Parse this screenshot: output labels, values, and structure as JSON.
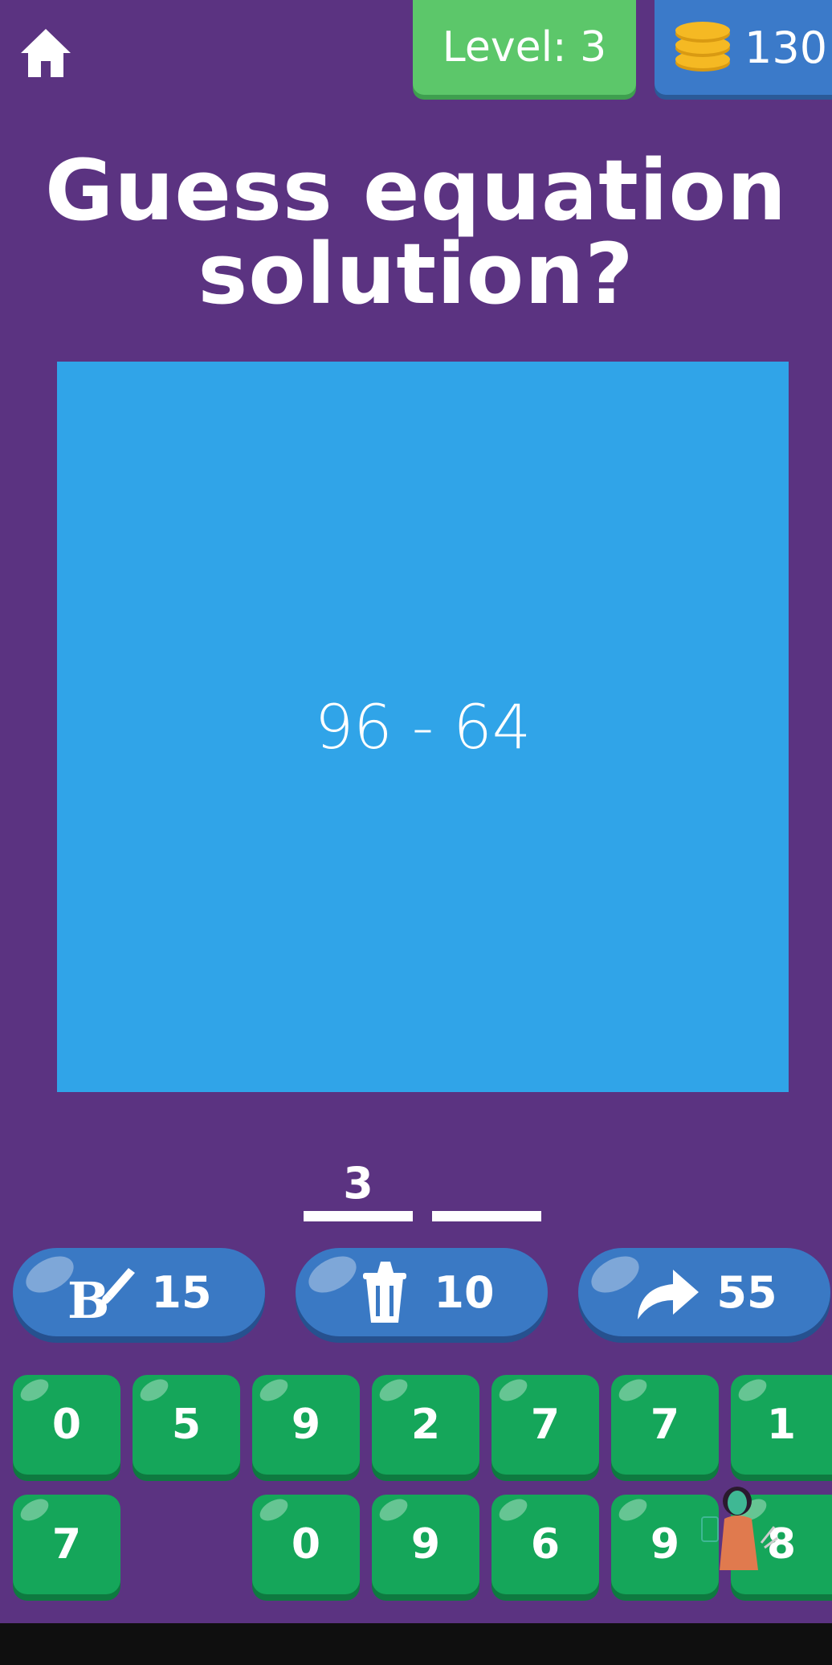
{
  "header": {
    "level_label": "Level: 3",
    "coins": "130",
    "icons": {
      "home": "home-icon",
      "coins": "coins-stack-icon"
    }
  },
  "question": {
    "line1": "Guess equation",
    "line2": "solution?"
  },
  "puzzle": {
    "equation": "96 - 64",
    "panel_color": "#30a4e8"
  },
  "answer": {
    "slots": [
      "3",
      ""
    ]
  },
  "hints": [
    {
      "icon": "paint-letter-icon",
      "cost": "15"
    },
    {
      "icon": "trash-can-icon",
      "cost": "10"
    },
    {
      "icon": "skip-arrow-icon",
      "cost": "55"
    }
  ],
  "keypad": {
    "row1": [
      "0",
      "5",
      "9",
      "2",
      "7",
      "7",
      "1"
    ],
    "row2": [
      "7",
      "",
      "0",
      "9",
      "6",
      "9",
      "8"
    ]
  },
  "colors": {
    "background": "#5b3381",
    "level_badge": "#5cc76a",
    "coin_badge": "#3b7ac9",
    "hint_button": "#3a79c4",
    "key": "#15a65a"
  }
}
